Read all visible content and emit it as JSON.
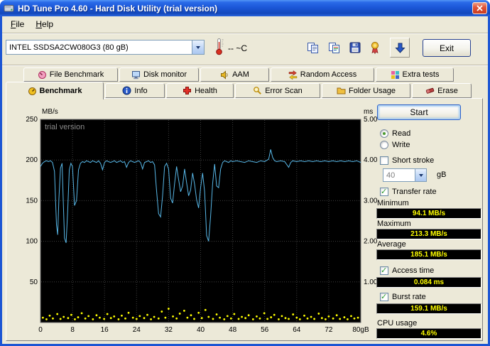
{
  "window": {
    "title": "HD Tune Pro 4.60 - Hard Disk Utility (trial version)"
  },
  "menu": {
    "items": [
      "File",
      "Help"
    ]
  },
  "toolbar": {
    "drive": "INTEL SSDSA2CW080G3 (80 gB)",
    "temperature": "-- ~C",
    "exit": "Exit"
  },
  "tabs": {
    "row1": [
      "File Benchmark",
      "Disk monitor",
      "AAM",
      "Random Access",
      "Extra tests"
    ],
    "row2": [
      "Benchmark",
      "Info",
      "Health",
      "Error Scan",
      "Folder Usage",
      "Erase"
    ],
    "active": "Benchmark"
  },
  "panel": {
    "start": "Start",
    "read": "Read",
    "write": "Write",
    "short_stroke": "Short stroke",
    "short_stroke_value": "40",
    "short_stroke_unit": "gB",
    "transfer_rate": "Transfer rate",
    "minimum_label": "Minimum",
    "minimum_value": "94.1 MB/s",
    "maximum_label": "Maximum",
    "maximum_value": "213.3 MB/s",
    "average_label": "Average",
    "average_value": "185.1 MB/s",
    "access_time_label": "Access time",
    "access_time_value": "0.084 ms",
    "burst_rate_label": "Burst rate",
    "burst_rate_value": "159.1 MB/s",
    "cpu_usage_label": "CPU usage",
    "cpu_usage_value": "4.6%"
  },
  "chart_data": {
    "type": "line",
    "watermark": "trial version",
    "x_max": 80,
    "x_ticks": [
      0,
      8,
      16,
      24,
      32,
      40,
      48,
      56,
      64,
      72,
      80
    ],
    "x_tick_labels": [
      "0",
      "8",
      "16",
      "24",
      "32",
      "40",
      "48",
      "56",
      "64",
      "72",
      "80gB"
    ],
    "left_axis": {
      "unit": "MB/s",
      "min": 0,
      "max": 250,
      "ticks": [
        250,
        200,
        150,
        100,
        50
      ]
    },
    "right_axis": {
      "unit": "ms",
      "min": 0,
      "max": 5,
      "ticks": [
        "5.00",
        "4.00",
        "3.00",
        "2.00",
        "1.00"
      ]
    },
    "series": [
      {
        "name": "Transfer rate",
        "type": "line",
        "axis": "left",
        "color": "#58b8e8",
        "points": [
          [
            0,
            192
          ],
          [
            0.5,
            196
          ],
          [
            1,
            198
          ],
          [
            1.5,
            199
          ],
          [
            2,
            198
          ],
          [
            2.5,
            199
          ],
          [
            3,
            197
          ],
          [
            3.5,
            186
          ],
          [
            4,
            120
          ],
          [
            4.3,
            108
          ],
          [
            4.6,
            152
          ],
          [
            5,
            190
          ],
          [
            5.4,
            196
          ],
          [
            5.7,
            148
          ],
          [
            6,
            104
          ],
          [
            6.4,
            98
          ],
          [
            6.8,
            138
          ],
          [
            7.2,
            188
          ],
          [
            7.6,
            196
          ],
          [
            8,
            192
          ],
          [
            8.5,
            144
          ],
          [
            9,
            150
          ],
          [
            9.5,
            188
          ],
          [
            10,
            196
          ],
          [
            10.5,
            198
          ],
          [
            11,
            197
          ],
          [
            11.5,
            199
          ],
          [
            12,
            198
          ],
          [
            12.5,
            197
          ],
          [
            13,
            199
          ],
          [
            13.5,
            198
          ],
          [
            14,
            197
          ],
          [
            14.5,
            199
          ],
          [
            15,
            196
          ],
          [
            15.5,
            188
          ],
          [
            16,
            197
          ],
          [
            16.5,
            199
          ],
          [
            17,
            198
          ],
          [
            17.5,
            197
          ],
          [
            18,
            198
          ],
          [
            18.5,
            199
          ],
          [
            19,
            197
          ],
          [
            19.5,
            198
          ],
          [
            20,
            199
          ],
          [
            20.5,
            197
          ],
          [
            21,
            198
          ],
          [
            21.5,
            191
          ],
          [
            22,
            197
          ],
          [
            22.5,
            199
          ],
          [
            23,
            198
          ],
          [
            23.5,
            197
          ],
          [
            24,
            198
          ],
          [
            24.5,
            199
          ],
          [
            25,
            197
          ],
          [
            25.5,
            189
          ],
          [
            26,
            197
          ],
          [
            26.5,
            198
          ],
          [
            27,
            199
          ],
          [
            27.5,
            197
          ],
          [
            28,
            198
          ],
          [
            28.5,
            194
          ],
          [
            29,
            162
          ],
          [
            29.5,
            134
          ],
          [
            30,
            130
          ],
          [
            30.5,
            156
          ],
          [
            31,
            192
          ],
          [
            31.5,
            196
          ],
          [
            32,
            189
          ],
          [
            32.5,
            153
          ],
          [
            33,
            147
          ],
          [
            33.5,
            171
          ],
          [
            34,
            192
          ],
          [
            34.5,
            176
          ],
          [
            35,
            161
          ],
          [
            35.5,
            168
          ],
          [
            36,
            189
          ],
          [
            36.5,
            172
          ],
          [
            37,
            156
          ],
          [
            37.5,
            163
          ],
          [
            38,
            184
          ],
          [
            38.5,
            170
          ],
          [
            39,
            151
          ],
          [
            39.5,
            141
          ],
          [
            40,
            166
          ],
          [
            40.5,
            184
          ],
          [
            41,
            161
          ],
          [
            41.5,
            107
          ],
          [
            42,
            100
          ],
          [
            42.5,
            131
          ],
          [
            43,
            171
          ],
          [
            43.5,
            195
          ],
          [
            44,
            168
          ],
          [
            44.5,
            166
          ],
          [
            45,
            189
          ],
          [
            45.5,
            197
          ],
          [
            46,
            199
          ],
          [
            46.5,
            198
          ],
          [
            47,
            197
          ],
          [
            47.5,
            199
          ],
          [
            48,
            198
          ],
          [
            49,
            199
          ],
          [
            50,
            198
          ],
          [
            51,
            197
          ],
          [
            52,
            199
          ],
          [
            53,
            198
          ],
          [
            54,
            197
          ],
          [
            55,
            199
          ],
          [
            56,
            198
          ],
          [
            57,
            201
          ],
          [
            57.5,
            213
          ],
          [
            58,
            203
          ],
          [
            58.5,
            199
          ],
          [
            59,
            198
          ],
          [
            60,
            199
          ],
          [
            61,
            198
          ],
          [
            62,
            191
          ],
          [
            62.5,
            197
          ],
          [
            63,
            199
          ],
          [
            64,
            198
          ],
          [
            65,
            199
          ],
          [
            66,
            198
          ],
          [
            67,
            199
          ],
          [
            68,
            198
          ],
          [
            69,
            199
          ],
          [
            70,
            198
          ],
          [
            71,
            199
          ],
          [
            72,
            198
          ],
          [
            73,
            199
          ],
          [
            74,
            198
          ],
          [
            75,
            199
          ],
          [
            76,
            198
          ],
          [
            77,
            199
          ],
          [
            78,
            198
          ],
          [
            79,
            199
          ],
          [
            80,
            197
          ]
        ]
      },
      {
        "name": "Access time",
        "type": "scatter",
        "axis": "right",
        "color": "#ffff00",
        "points": [
          [
            0.6,
            0.12
          ],
          [
            1.5,
            0.08
          ],
          [
            2.3,
            0.17
          ],
          [
            3.1,
            0.1
          ],
          [
            4.2,
            0.21
          ],
          [
            5,
            0.09
          ],
          [
            5.8,
            0.14
          ],
          [
            6.9,
            0.11
          ],
          [
            7.7,
            0.19
          ],
          [
            8.6,
            0.08
          ],
          [
            9.4,
            0.13
          ],
          [
            10.3,
            0.23
          ],
          [
            11.2,
            0.1
          ],
          [
            12,
            0.16
          ],
          [
            13.1,
            0.08
          ],
          [
            14,
            0.18
          ],
          [
            14.8,
            0.12
          ],
          [
            15.9,
            0.09
          ],
          [
            16.7,
            0.21
          ],
          [
            17.6,
            0.11
          ],
          [
            18.4,
            0.15
          ],
          [
            19.5,
            0.08
          ],
          [
            20.3,
            0.17
          ],
          [
            21.2,
            0.1
          ],
          [
            22,
            0.24
          ],
          [
            23.1,
            0.12
          ],
          [
            24,
            0.09
          ],
          [
            24.8,
            0.16
          ],
          [
            25.9,
            0.11
          ],
          [
            26.7,
            0.19
          ],
          [
            27.6,
            0.08
          ],
          [
            28.4,
            0.14
          ],
          [
            29.5,
            0.1
          ],
          [
            30.3,
            0.27
          ],
          [
            31.2,
            0.12
          ],
          [
            32,
            0.34
          ],
          [
            33.1,
            0.15
          ],
          [
            34,
            0.1
          ],
          [
            34.8,
            0.22
          ],
          [
            35.9,
            0.29
          ],
          [
            36.7,
            0.12
          ],
          [
            37.6,
            0.18
          ],
          [
            38.4,
            0.09
          ],
          [
            39.5,
            0.24
          ],
          [
            40.3,
            0.11
          ],
          [
            41.2,
            0.31
          ],
          [
            42,
            0.14
          ],
          [
            43.1,
            0.09
          ],
          [
            44,
            0.2
          ],
          [
            44.8,
            0.12
          ],
          [
            45.9,
            0.08
          ],
          [
            46.7,
            0.16
          ],
          [
            47.6,
            0.1
          ],
          [
            48.4,
            0.21
          ],
          [
            49.5,
            0.09
          ],
          [
            50.3,
            0.14
          ],
          [
            51.2,
            0.11
          ],
          [
            52,
            0.18
          ],
          [
            53.1,
            0.08
          ],
          [
            54,
            0.15
          ],
          [
            54.8,
            0.1
          ],
          [
            55.9,
            0.23
          ],
          [
            56.7,
            0.09
          ],
          [
            57.6,
            0.13
          ],
          [
            58.4,
            0.19
          ],
          [
            59.5,
            0.08
          ],
          [
            60.3,
            0.16
          ],
          [
            61.2,
            0.11
          ],
          [
            62,
            0.09
          ],
          [
            63.1,
            0.2
          ],
          [
            64,
            0.12
          ],
          [
            64.8,
            0.08
          ],
          [
            65.9,
            0.17
          ],
          [
            66.7,
            0.1
          ],
          [
            67.6,
            0.14
          ],
          [
            68.4,
            0.09
          ],
          [
            69.5,
            0.22
          ],
          [
            70.3,
            0.11
          ],
          [
            71.2,
            0.08
          ],
          [
            72,
            0.15
          ],
          [
            73.1,
            0.1
          ],
          [
            74,
            0.18
          ],
          [
            74.8,
            0.09
          ],
          [
            75.9,
            0.13
          ],
          [
            76.7,
            0.08
          ],
          [
            77.6,
            0.16
          ],
          [
            78.4,
            0.1
          ],
          [
            79.3,
            0.12
          ]
        ]
      }
    ],
    "stats": {
      "minimum_mbs": 94.1,
      "maximum_mbs": 213.3,
      "average_mbs": 185.1,
      "access_time_ms": 0.084,
      "burst_rate_mbs": 159.1,
      "cpu_usage_pct": 4.6
    }
  }
}
